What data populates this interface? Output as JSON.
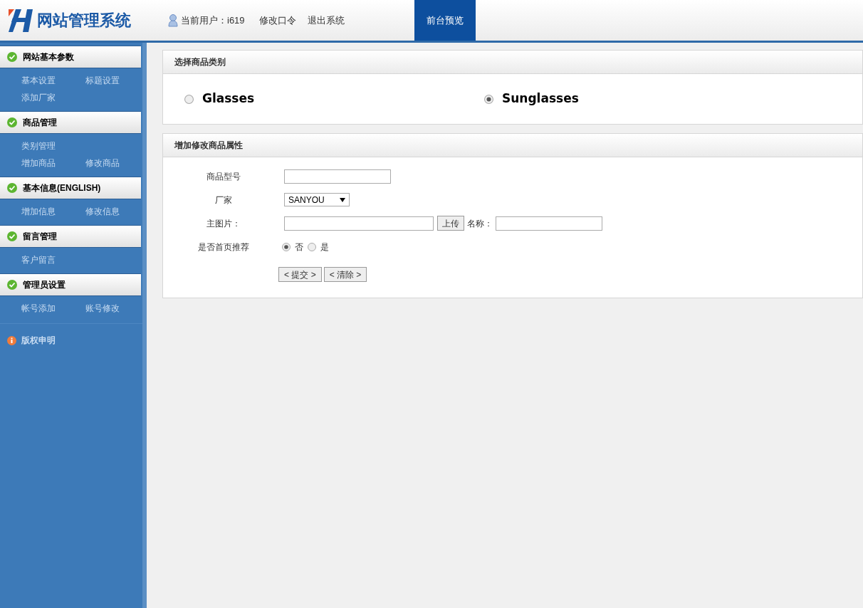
{
  "header": {
    "logo_text": "网站管理系统",
    "user_label": "当前用户：i619",
    "links": [
      "修改口令",
      "退出系统"
    ],
    "preview_button": "前台预览"
  },
  "sidebar": {
    "sections": [
      {
        "title": "网站基本参数",
        "rows": [
          [
            "基本设置",
            "标题设置"
          ],
          [
            "添加厂家"
          ]
        ]
      },
      {
        "title": "商品管理",
        "rows": [
          [
            "类别管理"
          ],
          [
            "增加商品",
            "修改商品"
          ]
        ]
      },
      {
        "title": "基本信息(ENGLISH)",
        "rows": [
          [
            "增加信息",
            "修改信息"
          ]
        ]
      },
      {
        "title": "留言管理",
        "rows": [
          [
            "客户留言"
          ]
        ]
      },
      {
        "title": "管理员设置",
        "rows": [
          [
            "帐号添加",
            "账号修改"
          ]
        ]
      }
    ],
    "footer": "版权申明"
  },
  "category_panel": {
    "title": "选择商品类别",
    "options": [
      {
        "label": "Glasses",
        "selected": false
      },
      {
        "label": "Sunglasses",
        "selected": true
      }
    ]
  },
  "form_panel": {
    "title": "增加修改商品属性",
    "model_label": "商品型号",
    "maker_label": "厂家",
    "maker_value": "SANYOU",
    "image_label": "主图片：",
    "upload_button": "上传",
    "name_label": "名称：",
    "recommend_label": "是否首页推荐",
    "recommend_options": [
      {
        "label": "否",
        "selected": true
      },
      {
        "label": "是",
        "selected": false
      }
    ],
    "buttons": [
      "< 提交 >",
      "< 清除 >"
    ]
  }
}
